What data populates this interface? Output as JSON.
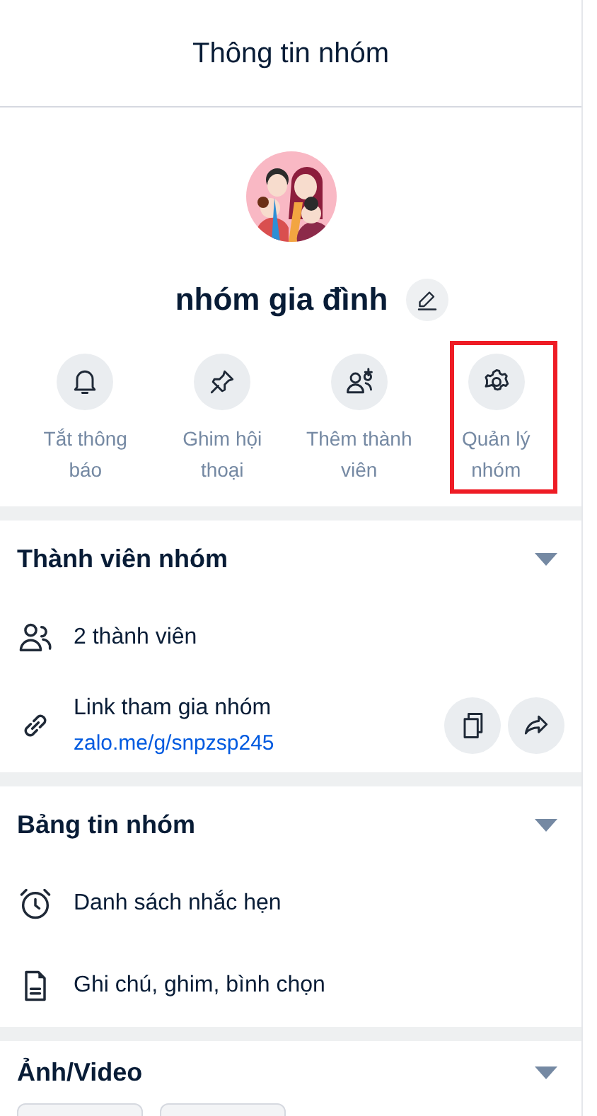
{
  "header": {
    "title": "Thông tin nhóm"
  },
  "group": {
    "name": "nhóm gia đình"
  },
  "actions": [
    {
      "kind": "bell",
      "label": "Tắt thông báo",
      "highlighted": false
    },
    {
      "kind": "pin",
      "label": "Ghim hội thoại",
      "highlighted": false
    },
    {
      "kind": "add-member",
      "label": "Thêm thành viên",
      "highlighted": false
    },
    {
      "kind": "gear",
      "label": "Quản lý nhóm",
      "highlighted": true
    }
  ],
  "sections": [
    {
      "title": "Thành viên nhóm",
      "expanded": true,
      "rows": [
        {
          "kind": "members",
          "text": "2 thành viên"
        },
        {
          "kind": "link",
          "text": "Link tham gia nhóm",
          "link": "zalo.me/g/snpzsp245"
        }
      ]
    },
    {
      "title": "Bảng tin nhóm",
      "expanded": true,
      "rows": [
        {
          "kind": "reminders",
          "text": "Danh sách nhắc hẹn"
        },
        {
          "kind": "notes",
          "text": "Ghi chú, ghim, bình chọn"
        }
      ]
    },
    {
      "title": "Ảnh/Video",
      "expanded": true
    }
  ]
}
